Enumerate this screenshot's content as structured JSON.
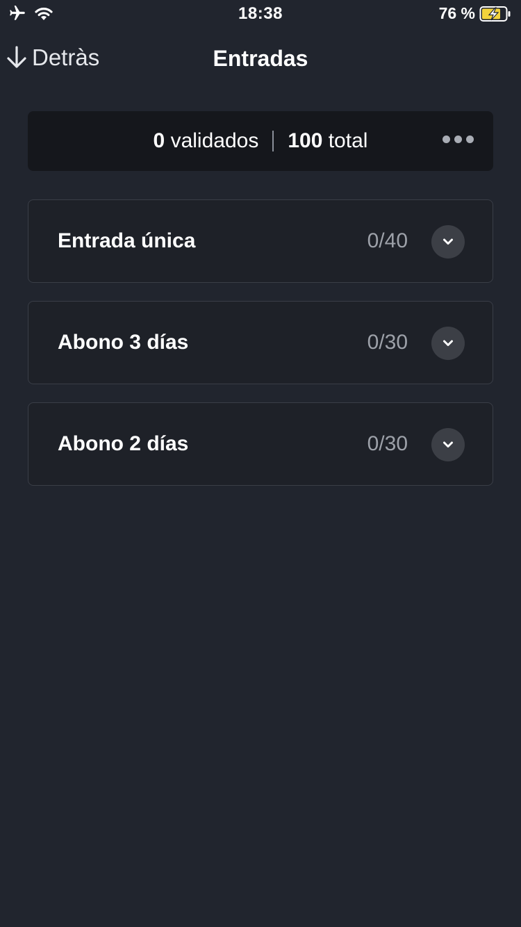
{
  "status_bar": {
    "time": "18:38",
    "battery_text": "76 %",
    "icons": [
      "airplane-icon",
      "wifi-icon",
      "battery-charging-icon"
    ]
  },
  "nav": {
    "back_label": "Detràs",
    "title": "Entradas"
  },
  "summary": {
    "validated_count": "0",
    "validated_label": " validados",
    "total_count": "100",
    "total_label": " total"
  },
  "tickets": [
    {
      "name": "Entrada única",
      "count": "0/40"
    },
    {
      "name": "Abono 3 días",
      "count": "0/30"
    },
    {
      "name": "Abono 2 días",
      "count": "0/30"
    }
  ],
  "colors": {
    "background": "#21252e",
    "summary_card": "#15171c",
    "ticket_card": "#1e2128",
    "card_border": "#3a3e47",
    "muted_text": "#9da1a9",
    "battery_accent": "#f2d33c"
  }
}
